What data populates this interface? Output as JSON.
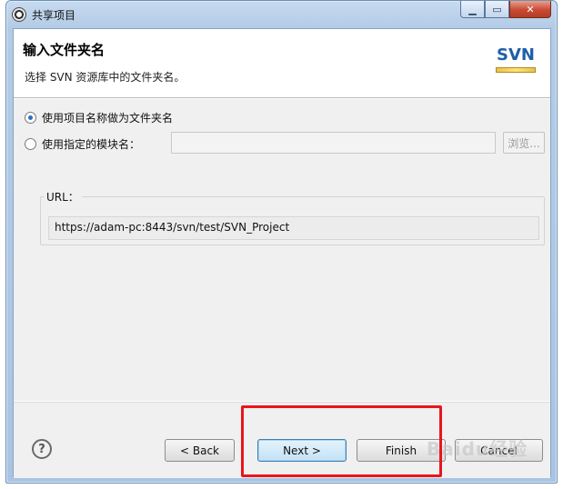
{
  "window": {
    "title": "共享项目"
  },
  "header": {
    "title": "输入文件夹名",
    "description": "选择 SVN 资源库中的文件夹名。",
    "logo_text": "SVN"
  },
  "options": {
    "use_project_name": "使用项目名称做为文件夹名",
    "use_module_name": "使用指定的模块名：",
    "module_name_value": "",
    "browse_label": "浏览..."
  },
  "url_group": {
    "label": "URL：",
    "value": "https://adam-pc:8443/svn/test/SVN_Project"
  },
  "footer": {
    "help_symbol": "?",
    "back_label": "< Back",
    "next_label": "Next >",
    "finish_label": "Finish",
    "cancel_label": "Cancel"
  },
  "watermark": "Baidu经验",
  "colors": {
    "highlight": "#e8161c",
    "accent": "#3c7fb1"
  }
}
